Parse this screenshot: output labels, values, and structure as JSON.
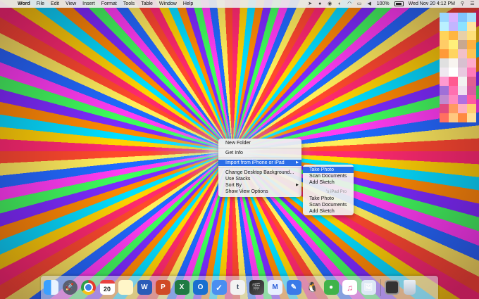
{
  "menubar": {
    "apple_glyph": "",
    "app_name": "Word",
    "menus": [
      "File",
      "Edit",
      "View",
      "Insert",
      "Format",
      "Tools",
      "Table",
      "Window",
      "Help"
    ],
    "battery": "100%",
    "datetime": "Wed Nov 20  4:12 PM"
  },
  "context_menu": {
    "new_folder": "New Folder",
    "get_info": "Get Info",
    "import": "Import from iPhone or iPad",
    "change_bg": "Change Desktop Background...",
    "use_stacks": "Use Stacks",
    "sort_by": "Sort By",
    "show_view_options": "Show View Options"
  },
  "submenu": {
    "group1": [
      "Take Photo",
      "Scan Documents",
      "Add Sketch"
    ],
    "device2": "'s iPad Pro",
    "group2": [
      "Take Photo",
      "Scan Documents",
      "Add Sketch"
    ]
  },
  "dock": {
    "calendar_day": "20",
    "tumblr_glyph": "t",
    "word_glyph": "W",
    "powerpoint_glyph": "P",
    "excel_glyph": "X",
    "outlook_glyph": "O"
  }
}
